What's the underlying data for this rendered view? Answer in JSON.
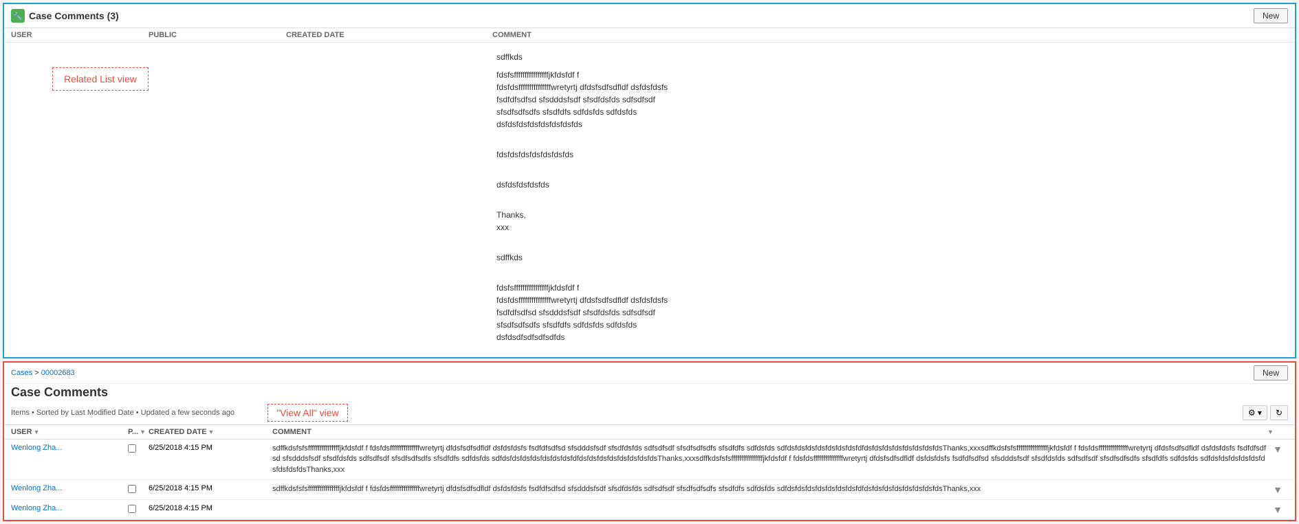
{
  "top_panel": {
    "title": "Case Comments (3)",
    "new_button": "New",
    "columns": [
      "USER",
      "PUBLIC",
      "CREATED DATE",
      "COMMENT"
    ],
    "related_list_label": "Related List view",
    "comments": [
      "sdffkds",
      "fdsfsffffffffffffffffjkfdsfdf f\nfdsfdsfffffffffffffffwretyrtj dfdsfsdfsdfldf dsfdsfdsfs\nfsdfdfsdfsd sfsdddsfsdf sfsdfdsfds sdfsdfsdf\nsfsdfsdfsdfs sfsdfdfs sdfdsfds\ndsfdsfdsfdsfdsfdsfdsfds",
      "",
      "fdsfdsfdsfdsfdsfdsfds",
      "",
      "dsfdsfdsfdsfds",
      "",
      "Thanks,\nxxx",
      "",
      "sdffkds",
      "",
      "fdsfsffffffffffffffffjkfdsfdf f\nfdsfdsfffffffffffffffwretyrtj dfdsfsdfsdfldf dsfdsfdsfs\nfsdfdfsdfsd sfsdddsfsdf sfsdfdsfds sdfsdfsdf\nsfsdfsdfsdfs sfsdfdfs sdfdsfds\ndsfdsdfsdfsdfsdfds"
    ]
  },
  "bottom_panel": {
    "breadcrumb_cases": "Cases",
    "breadcrumb_separator": " > ",
    "breadcrumb_case_id": "00002683",
    "title": "Case Comments",
    "new_button": "New",
    "subtitle": "Items • Sorted by Last Modified Date • Updated a few seconds ago",
    "view_all_label": "\"View All\" view",
    "columns": [
      "USER",
      "P...",
      "CREATED DATE",
      "COMMENT"
    ],
    "rows": [
      {
        "user": "Wenlong Zha...",
        "date": "6/25/2018 4:15 PM",
        "comment": "sdffkdsfsfsffffffffffffffffjkfdsfdf f fdsfdsfffffffffffffffwretyrtj dfdsfsdfsdfldf dsfdsfdsfs fsdfdfsdfsd sfsdddsfsdf sfsdfdsfds sdfsdfsdf sfsdfsdfsdfs sfsdfdfs sdfdsfds sdfdsfdsfdsfdsfdsfdsfdsfdfdsfdsfdsfdsfdsfdsfdsfdsThanks,xxxsdffkdsfsfsffffffffffffffffjkfdsfdf f fdsfdsfffffffffffffffwretyrtj dfdsfsdfsdfldf dsfdsfdsfs fsdfdfsdfsd sfsdddsfsdf sfsdfdsfds sdfsdfsdf sfsdfsdfsdfs sfsdfdfs sdfdsfds sdfdsfdsfdsfdsfdsfdsfdsfdfdsfdsfdsfdsfdsfdsfdsfdsThanks,xxxsdffkdsfsfsffffffffffffffffjkfdsfdf f fdsfdsfffffffffffffffwretyrtj dfdsfsdfsdfldf dsfdsfdsfs fsdfdfsdfsd sfsdddsfsdf sfsdfdsfds sdfsdfsdf sfsdfsdfsdfs sfsdfdfs sdfdsfds sdfdsfdsfdsfdsfdsfdsfdsfdsfdsThanks,xxx"
      },
      {
        "user": "Wenlong Zha...",
        "date": "6/25/2018 4:15 PM",
        "comment": "sdffkdsfsfsffffffffffffffffjkfdsfdf f fdsfdsfffffffffffffffwretyrtj dfdsfsdfsdfldf dsfdsfdsfs fsdfdfsdfsd sfsdddsfsdf sfsdfdsfds sdfsdfsdf sfsdfsdfsdfs sfsdfdfs sdfdsfds sdfdsfdsfdsfdsfdsfdsfdsfdfdsfdsfdsfdsfdsfdsfdsfdsThanks,xxx"
      },
      {
        "user": "Wenlong Zha...",
        "date": "6/25/2018 4:15 PM",
        "comment": ""
      }
    ]
  }
}
